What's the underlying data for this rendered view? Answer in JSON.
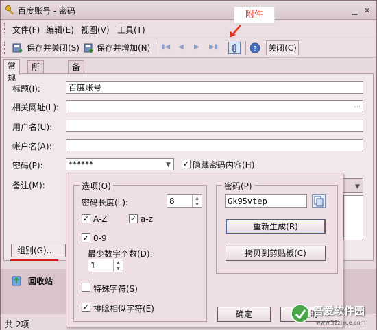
{
  "window": {
    "title": "百度账号 - 密码",
    "annotation": "附件"
  },
  "menu": [
    "文件(F)",
    "编辑(E)",
    "视图(V)",
    "工具(T)"
  ],
  "toolbar": {
    "save_close": "保存并关闭(S)",
    "save_add": "保存并增加(N)",
    "close": "关闭(C)"
  },
  "tabs": [
    "常规",
    "所有字段",
    "备注"
  ],
  "form": {
    "title_label": "标题(I):",
    "title_value": "百度账号",
    "url_label": "相关网址(L):",
    "url_value": "",
    "url_button": "...",
    "user_label": "用户名(U):",
    "user_value": "",
    "account_label": "帐户名(A):",
    "account_value": "",
    "password_label": "密码(P):",
    "password_value": "******",
    "hide_password_label": "隐藏密码内容(H)",
    "hide_password_checked": true,
    "notes_label": "备注(M):",
    "group_button": "组别(G)..."
  },
  "sidebar": {
    "recycle_label": "回收站"
  },
  "status": {
    "count": "共 2项"
  },
  "popup": {
    "options_title": "选项(O)",
    "length_label": "密码长度(L):",
    "length_value": "8",
    "az_upper_label": "A-Z",
    "az_upper_checked": true,
    "az_lower_label": "a-z",
    "az_lower_checked": true,
    "digits_label": "0-9",
    "digits_checked": true,
    "min_digits_label": "最少数字个数(D):",
    "min_digits_value": "1",
    "special_label": "特殊字符(S)",
    "special_checked": false,
    "exclude_similar_label": "排除相似字符(E)",
    "exclude_similar_checked": true,
    "password_title": "密码(P)",
    "generated_password": "Gk95vtep",
    "regenerate_button": "重新生成(R)",
    "copy_button": "拷贝到剪贴板(C)",
    "ok_button": "确定",
    "cancel_button": "取消"
  },
  "watermark": {
    "brand": "吾爱软件园",
    "url": "www.52zixue.com"
  },
  "colors": {
    "window_bg": "#e7dade",
    "panel_bg": "#f1e8eb",
    "annotation_red": "#e0301e",
    "underline_red": "#d01c1c"
  }
}
